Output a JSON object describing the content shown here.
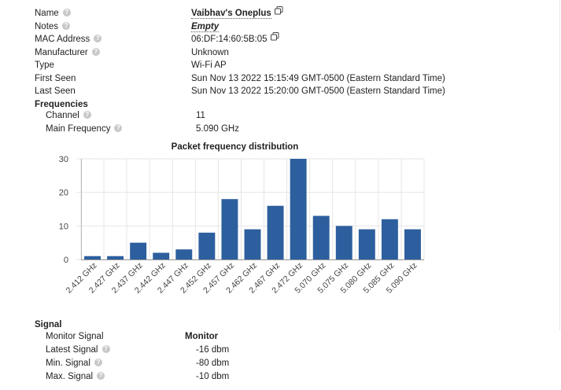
{
  "device": {
    "name_label": "Name",
    "name_value": "Vaibhav's Oneplus",
    "notes_label": "Notes",
    "notes_value": "Empty",
    "mac_label": "MAC Address",
    "mac_value": "06:DF:14:60:5B:05",
    "manufacturer_label": "Manufacturer",
    "manufacturer_value": "Unknown",
    "type_label": "Type",
    "type_value": "Wi-Fi AP",
    "first_seen_label": "First Seen",
    "first_seen_value": "Sun Nov 13 2022 15:15:49 GMT-0500 (Eastern Standard Time)",
    "last_seen_label": "Last Seen",
    "last_seen_value": "Sun Nov 13 2022 15:20:00 GMT-0500 (Eastern Standard Time)"
  },
  "frequencies": {
    "heading": "Frequencies",
    "channel_label": "Channel",
    "channel_value": "11",
    "main_freq_label": "Main Frequency",
    "main_freq_value": "5.090 GHz"
  },
  "signal": {
    "heading": "Signal",
    "monitor_label": "Monitor Signal",
    "monitor_value": "Monitor",
    "latest_label": "Latest Signal",
    "latest_value": "-16 dbm",
    "min_label": "Min. Signal",
    "min_value": "-80 dbm",
    "max_label": "Max. Signal",
    "max_value": "-10 dbm"
  },
  "icons": {
    "help": "question-circle-icon",
    "copy": "copy-icon"
  },
  "colors": {
    "bar": "#2d5f9e",
    "grid": "#e6e6e6"
  },
  "chart_data": {
    "type": "bar",
    "title": "Packet frequency distribution",
    "categories": [
      "2.412 GHz",
      "2.427 GHz",
      "2.437 GHz",
      "2.442 GHz",
      "2.447 GHz",
      "2.452 GHz",
      "2.457 GHz",
      "2.462 GHz",
      "2.467 GHz",
      "2.472 GHz",
      "5.070 GHz",
      "5.075 GHz",
      "5.080 GHz",
      "5.085 GHz",
      "5.090 GHz"
    ],
    "values": [
      1,
      1,
      5,
      2,
      3,
      8,
      18,
      9,
      16,
      30,
      13,
      10,
      9,
      12,
      9
    ],
    "ylim": [
      0,
      30
    ],
    "yticks": [
      "0",
      "10",
      "20",
      "30"
    ],
    "grid": true
  }
}
